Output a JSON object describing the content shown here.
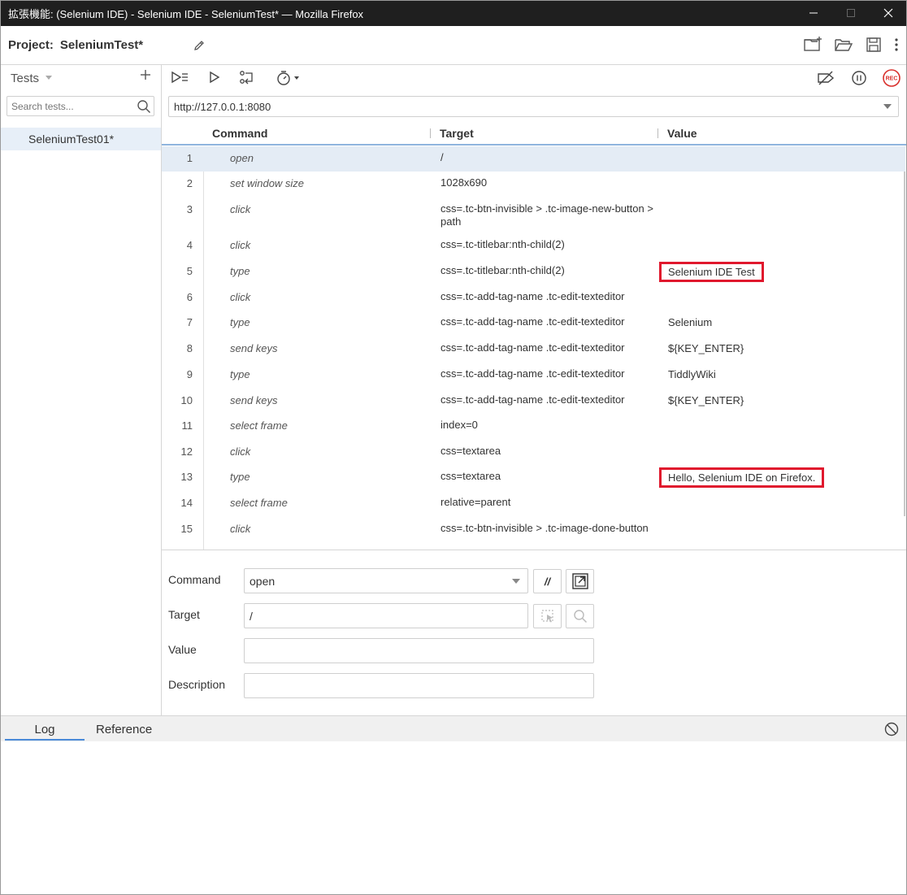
{
  "window": {
    "title": "拡張機能: (Selenium IDE) - Selenium IDE - SeleniumTest* — Mozilla Firefox",
    "controls": [
      "minimize-icon",
      "maximize-icon",
      "close-icon"
    ]
  },
  "project": {
    "label": "Project:",
    "name": "SeleniumTest*",
    "actions": [
      "new-project-icon",
      "open-folder-icon",
      "save-icon",
      "more-vert-icon"
    ]
  },
  "tests_panel": {
    "header": "Tests",
    "search_placeholder": "Search tests...",
    "items": [
      {
        "name": "SeleniumTest01*",
        "selected": true
      }
    ]
  },
  "toolbar": {
    "icons": [
      "run-all-tests-icon",
      "run-current-test-icon",
      "step-over-icon",
      "speed-timer-icon",
      "disable-breakpoints-icon",
      "pause-icon",
      "record-icon"
    ],
    "record_label": "REC"
  },
  "url": {
    "value": "http://127.0.0.1:8080"
  },
  "table": {
    "headers": {
      "command": "Command",
      "target": "Target",
      "value": "Value"
    },
    "rows": [
      {
        "num": "1",
        "command": "open",
        "target": "/",
        "value": "",
        "selected": true
      },
      {
        "num": "2",
        "command": "set window size",
        "target": "1028x690",
        "value": ""
      },
      {
        "num": "3",
        "command": "click",
        "target": "css=.tc-btn-invisible > .tc-image-new-button > path",
        "value": ""
      },
      {
        "num": "4",
        "command": "click",
        "target": "css=.tc-titlebar:nth-child(2)",
        "value": ""
      },
      {
        "num": "5",
        "command": "type",
        "target": "css=.tc-titlebar:nth-child(2)",
        "value": "Selenium IDE Test",
        "highlight": true
      },
      {
        "num": "6",
        "command": "click",
        "target": "css=.tc-add-tag-name .tc-edit-texteditor",
        "value": ""
      },
      {
        "num": "7",
        "command": "type",
        "target": "css=.tc-add-tag-name .tc-edit-texteditor",
        "value": "Selenium"
      },
      {
        "num": "8",
        "command": "send keys",
        "target": "css=.tc-add-tag-name .tc-edit-texteditor",
        "value": "${KEY_ENTER}"
      },
      {
        "num": "9",
        "command": "type",
        "target": "css=.tc-add-tag-name .tc-edit-texteditor",
        "value": "TiddlyWiki"
      },
      {
        "num": "10",
        "command": "send keys",
        "target": "css=.tc-add-tag-name .tc-edit-texteditor",
        "value": "${KEY_ENTER}"
      },
      {
        "num": "11",
        "command": "select frame",
        "target": "index=0",
        "value": ""
      },
      {
        "num": "12",
        "command": "click",
        "target": "css=textarea",
        "value": ""
      },
      {
        "num": "13",
        "command": "type",
        "target": "css=textarea",
        "value": "Hello, Selenium IDE on Firefox.",
        "highlight": true
      },
      {
        "num": "14",
        "command": "select frame",
        "target": "relative=parent",
        "value": ""
      },
      {
        "num": "15",
        "command": "click",
        "target": "css=.tc-btn-invisible > .tc-image-done-button",
        "value": ""
      }
    ]
  },
  "editor": {
    "command_label": "Command",
    "command_value": "open",
    "comment_toggle_label": "//",
    "target_label": "Target",
    "target_value": "/",
    "value_label": "Value",
    "value_value": "",
    "description_label": "Description",
    "description_value": ""
  },
  "log_panel": {
    "tabs": [
      "Log",
      "Reference"
    ],
    "active_tab": "Log"
  },
  "colors": {
    "titlebar": "#1f1f1f",
    "selection": "#e4ecf5",
    "highlight_box": "#e0182d",
    "record": "#d9302c",
    "accent": "#4a8ad8"
  }
}
